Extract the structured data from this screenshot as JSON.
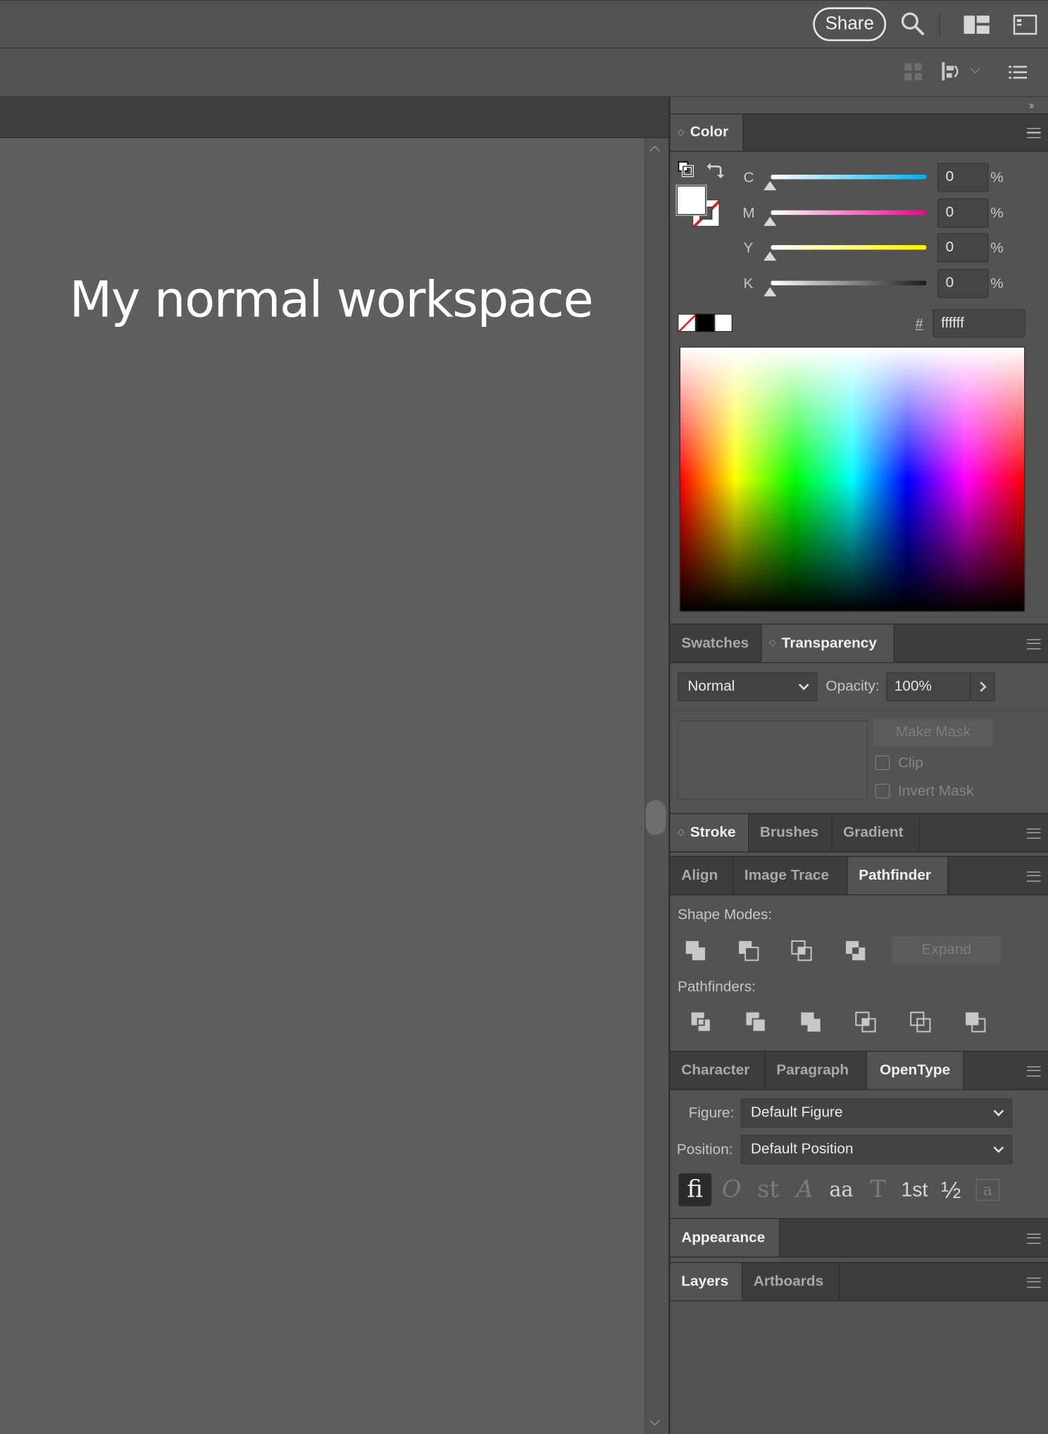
{
  "appbar": {
    "share_label": "Share"
  },
  "artboard": {
    "title": "My normal workspace"
  },
  "color_panel": {
    "tab_label": "Color",
    "channels": [
      {
        "label": "C",
        "value": "0",
        "unit": "%"
      },
      {
        "label": "M",
        "value": "0",
        "unit": "%"
      },
      {
        "label": "Y",
        "value": "0",
        "unit": "%"
      },
      {
        "label": "K",
        "value": "0",
        "unit": "%"
      }
    ],
    "hex_symbol": "#",
    "hex_value": "ffffff"
  },
  "transparency_panel": {
    "tabs": [
      "Swatches",
      "Transparency"
    ],
    "blend_mode": "Normal",
    "opacity_label": "Opacity:",
    "opacity_value": "100%",
    "make_mask": "Make Mask",
    "clip": "Clip",
    "invert_mask": "Invert Mask"
  },
  "stroke_group": {
    "tabs": [
      "Stroke",
      "Brushes",
      "Gradient"
    ]
  },
  "pathfinder_group": {
    "tabs": [
      "Align",
      "Image Trace",
      "Pathfinder"
    ],
    "shape_modes_label": "Shape Modes:",
    "expand_label": "Expand",
    "pathfinders_label": "Pathfinders:"
  },
  "opentype_group": {
    "tabs": [
      "Character",
      "Paragraph",
      "OpenType"
    ],
    "figure_label": "Figure:",
    "figure_value": "Default Figure",
    "position_label": "Position:",
    "position_value": "Default Position",
    "glyphs": [
      "fi",
      "O",
      "st",
      "A",
      "aa",
      "T",
      "1st",
      "½",
      "a"
    ]
  },
  "appearance_group": {
    "tabs": [
      "Appearance"
    ]
  },
  "layers_group": {
    "tabs": [
      "Layers",
      "Artboards"
    ]
  }
}
